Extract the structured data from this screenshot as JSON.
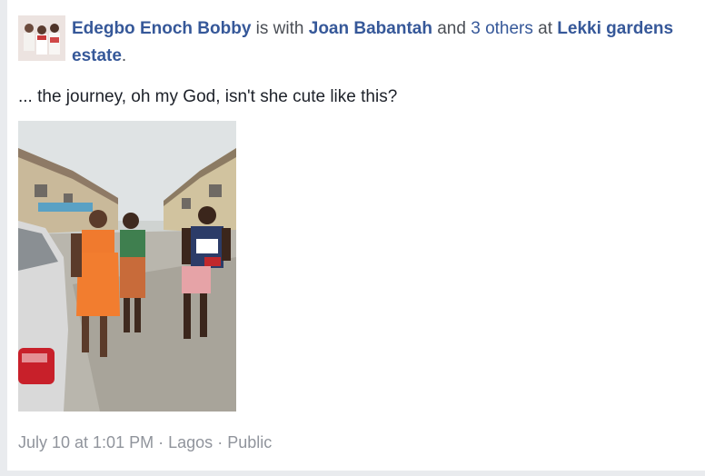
{
  "post": {
    "author": "Edegbo Enoch Bobby",
    "word_is_with": "is with",
    "tagged_person": "Joan Babantah",
    "word_and": "and",
    "others": "3 others",
    "word_at": "at",
    "location": "Lekki gardens estate",
    "period": ".",
    "text": "... the journey, oh my God, isn't she cute like this?",
    "timestamp": "July 10 at 1:01 PM",
    "separator": "·",
    "place": "Lagos",
    "privacy": "Public"
  }
}
